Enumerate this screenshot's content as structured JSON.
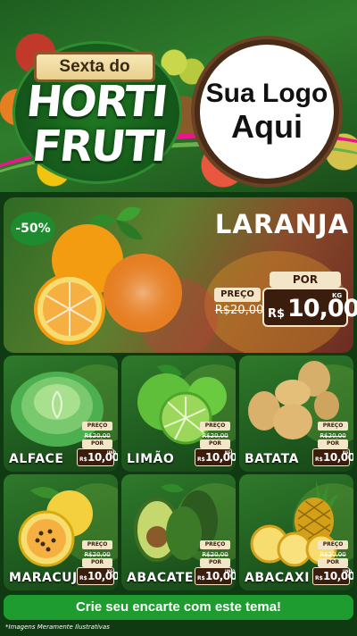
{
  "header": {
    "sign": "Sexta do",
    "title_line1": "HORTI",
    "title_line2": "FRUTI",
    "logo_line1": "Sua Logo",
    "logo_line2": "Aqui"
  },
  "featured": {
    "discount": "-50%",
    "name": "LARANJA",
    "preco_label": "PREÇO",
    "old_price": "R$20,00",
    "por_label": "POR",
    "currency": "R$",
    "price": "10,00",
    "unit": "KG"
  },
  "products": [
    {
      "name": "ALFACE",
      "preco_label": "PREÇO",
      "old_price": "R$20,00",
      "por_label": "POR",
      "currency": "R$",
      "price": "10,00",
      "unit": "UND"
    },
    {
      "name": "LIMÃO",
      "preco_label": "PREÇO",
      "old_price": "R$20,00",
      "por_label": "POR",
      "currency": "R$",
      "price": "10,00",
      "unit": "KG"
    },
    {
      "name": "BATATA",
      "preco_label": "PREÇO",
      "old_price": "R$20,00",
      "por_label": "POR",
      "currency": "R$",
      "price": "10,00",
      "unit": "KG"
    },
    {
      "name": "MARACUJÁ",
      "preco_label": "PREÇO",
      "old_price": "R$20,00",
      "por_label": "POR",
      "currency": "R$",
      "price": "10,00",
      "unit": "KG"
    },
    {
      "name": "ABACATE",
      "preco_label": "PREÇO",
      "old_price": "R$20,00",
      "por_label": "POR",
      "currency": "R$",
      "price": "10,00",
      "unit": "UNID"
    },
    {
      "name": "ABACAXI",
      "preco_label": "PREÇO",
      "old_price": "R$20,00",
      "por_label": "POR",
      "currency": "R$",
      "price": "10,00",
      "unit": "UND"
    }
  ],
  "footer": {
    "cta": "Crie seu encarte com este tema!",
    "disclaimer": "*Imagens Meramente Ilustrativas"
  },
  "colors": {
    "brand_green": "#1e9c2f",
    "price_brown": "#3b1d0e",
    "price_cream": "#f3e6c8",
    "accent_pink": "#e8158c"
  }
}
